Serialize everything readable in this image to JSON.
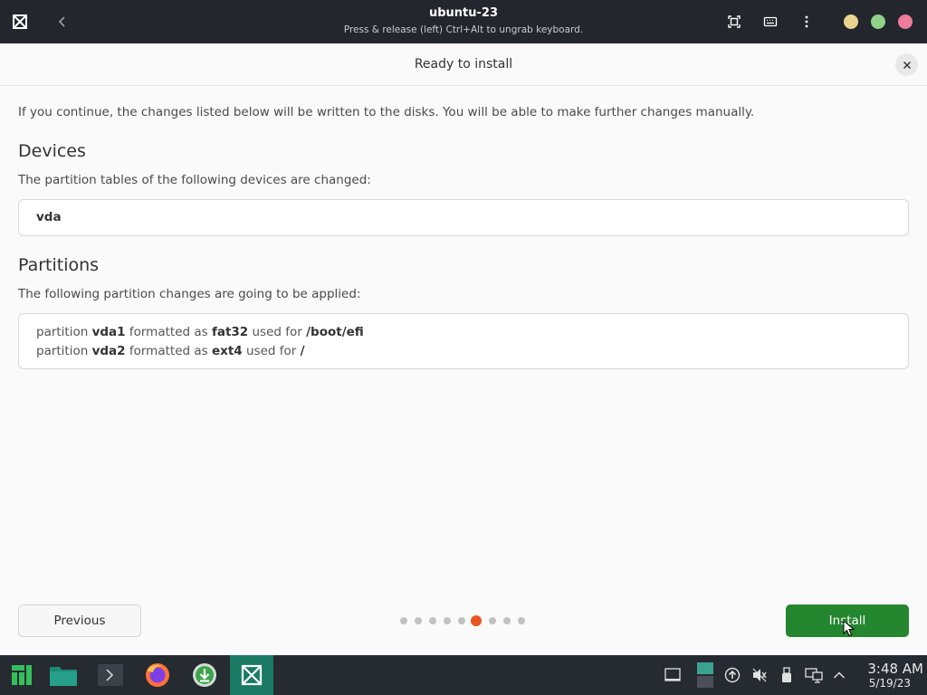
{
  "window": {
    "title": "ubuntu-23",
    "subtitle": "Press & release (left) Ctrl+Alt to ungrab keyboard.",
    "traffic_colors": [
      "#e9d38f",
      "#8fd18a",
      "#ec7c98"
    ]
  },
  "installer": {
    "page_title": "Ready to install",
    "intro": "If you continue, the changes listed below will be written to the disks. You will be able to make further changes manually.",
    "devices": {
      "heading": "Devices",
      "description": "The partition tables of the following devices are changed:",
      "items": [
        "vda"
      ]
    },
    "partitions": {
      "heading": "Partitions",
      "description": "The following partition changes are going to be applied:",
      "items": [
        {
          "prefix": "partition",
          "name": "vda1",
          "mid": "formatted as",
          "fs": "fat32",
          "suffix": "used for",
          "mount": "/boot/efi"
        },
        {
          "prefix": "partition",
          "name": "vda2",
          "mid": "formatted as",
          "fs": "ext4",
          "suffix": "used for",
          "mount": "/"
        }
      ]
    },
    "previous_label": "Previous",
    "install_label": "Install",
    "pager": {
      "total": 9,
      "active_index": 5
    },
    "colors": {
      "accent": "#e95420",
      "install": "#24862e"
    }
  },
  "taskbar": {
    "apps": [
      "manjaro-menu-icon",
      "file-manager-icon",
      "terminal-icon",
      "firefox-icon",
      "download-icon",
      "boxes-icon"
    ],
    "active_app": "boxes-icon",
    "tray": [
      "display-icon",
      "monitor-icon",
      "updates-icon",
      "volume-muted-icon",
      "usb-icon",
      "network-icon",
      "expand-tray-icon"
    ],
    "clock": {
      "time": "3:48 AM",
      "date": "5/19/23"
    }
  }
}
